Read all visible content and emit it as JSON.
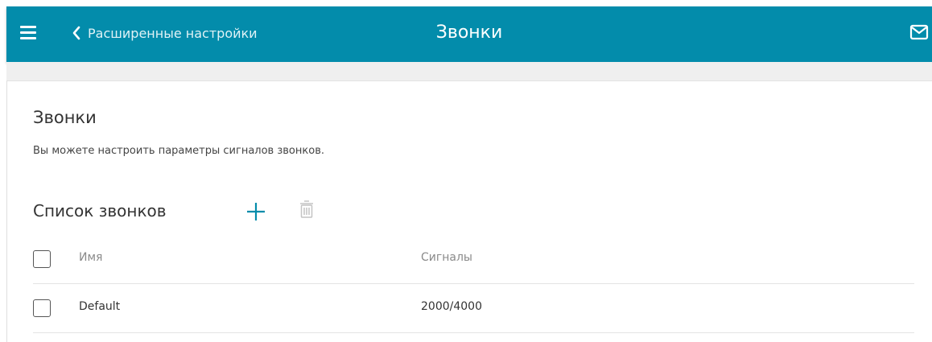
{
  "header": {
    "back_label": "Расширенные настройки",
    "title": "Звонки",
    "bg_color": "#038cab",
    "icons": {
      "menu": "hamburger-menu-icon",
      "back": "chevron-left-icon",
      "mail": "mail-icon"
    }
  },
  "section": {
    "title": "Звонки",
    "description": "Вы можете настроить параметры сигналов звонков."
  },
  "list": {
    "title": "Список звонков",
    "icons": {
      "add": "plus-icon",
      "delete": "trash-icon"
    },
    "columns": [
      "Имя",
      "Сигналы"
    ],
    "rows": [
      {
        "name": "Default",
        "signals": "2000/4000"
      }
    ]
  }
}
